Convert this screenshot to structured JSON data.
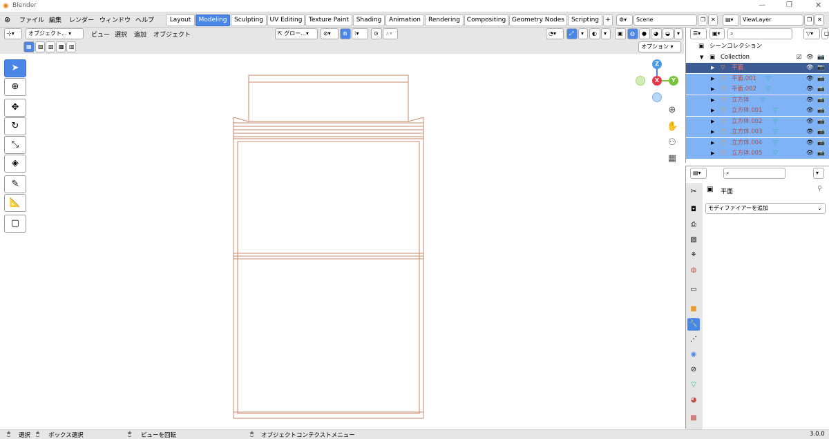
{
  "app": {
    "title": "Blender",
    "version": "3.0.0"
  },
  "menu": {
    "file": "ファイル",
    "edit": "編集",
    "render": "レンダー",
    "window": "ウィンドウ",
    "help": "ヘルプ"
  },
  "workspaces": [
    "Layout",
    "Modeling",
    "Sculpting",
    "UV Editing",
    "Texture Paint",
    "Shading",
    "Animation",
    "Rendering",
    "Compositing",
    "Geometry Nodes",
    "Scripting"
  ],
  "active_workspace": "Modeling",
  "scene": {
    "name": "Scene",
    "view_layer": "ViewLayer"
  },
  "viewport_header": {
    "mode": "オブジェクト...",
    "view": "ビュー",
    "select": "選択",
    "add": "追加",
    "object": "オブジェクト",
    "transform": "グロー...",
    "options": "オプション"
  },
  "outliner": {
    "scene_collection": "シーンコレクション",
    "collection": "Collection",
    "items": [
      {
        "name": "平面",
        "active": true
      },
      {
        "name": "平面.001"
      },
      {
        "name": "平面.002"
      },
      {
        "name": "立方体"
      },
      {
        "name": "立方体.001"
      },
      {
        "name": "立方体.002"
      },
      {
        "name": "立方体.003"
      },
      {
        "name": "立方体.004"
      },
      {
        "name": "立方体.005"
      }
    ]
  },
  "properties": {
    "object_name": "平面",
    "add_modifier": "モディファイアーを追加"
  },
  "gizmo": {
    "z": "Z",
    "x": "X",
    "y": "Y"
  },
  "statusbar": {
    "select": "選択",
    "box_select": "ボックス選択",
    "rotate_view": "ビューを回転",
    "context_menu": "オブジェクトコンテクストメニュー",
    "version": "3.0.0"
  },
  "colors": {
    "accent": "#4a86e8",
    "selected_row": "#7fb3f5",
    "active_row": "#3d5c94",
    "mesh_wire": "#c8866a"
  }
}
